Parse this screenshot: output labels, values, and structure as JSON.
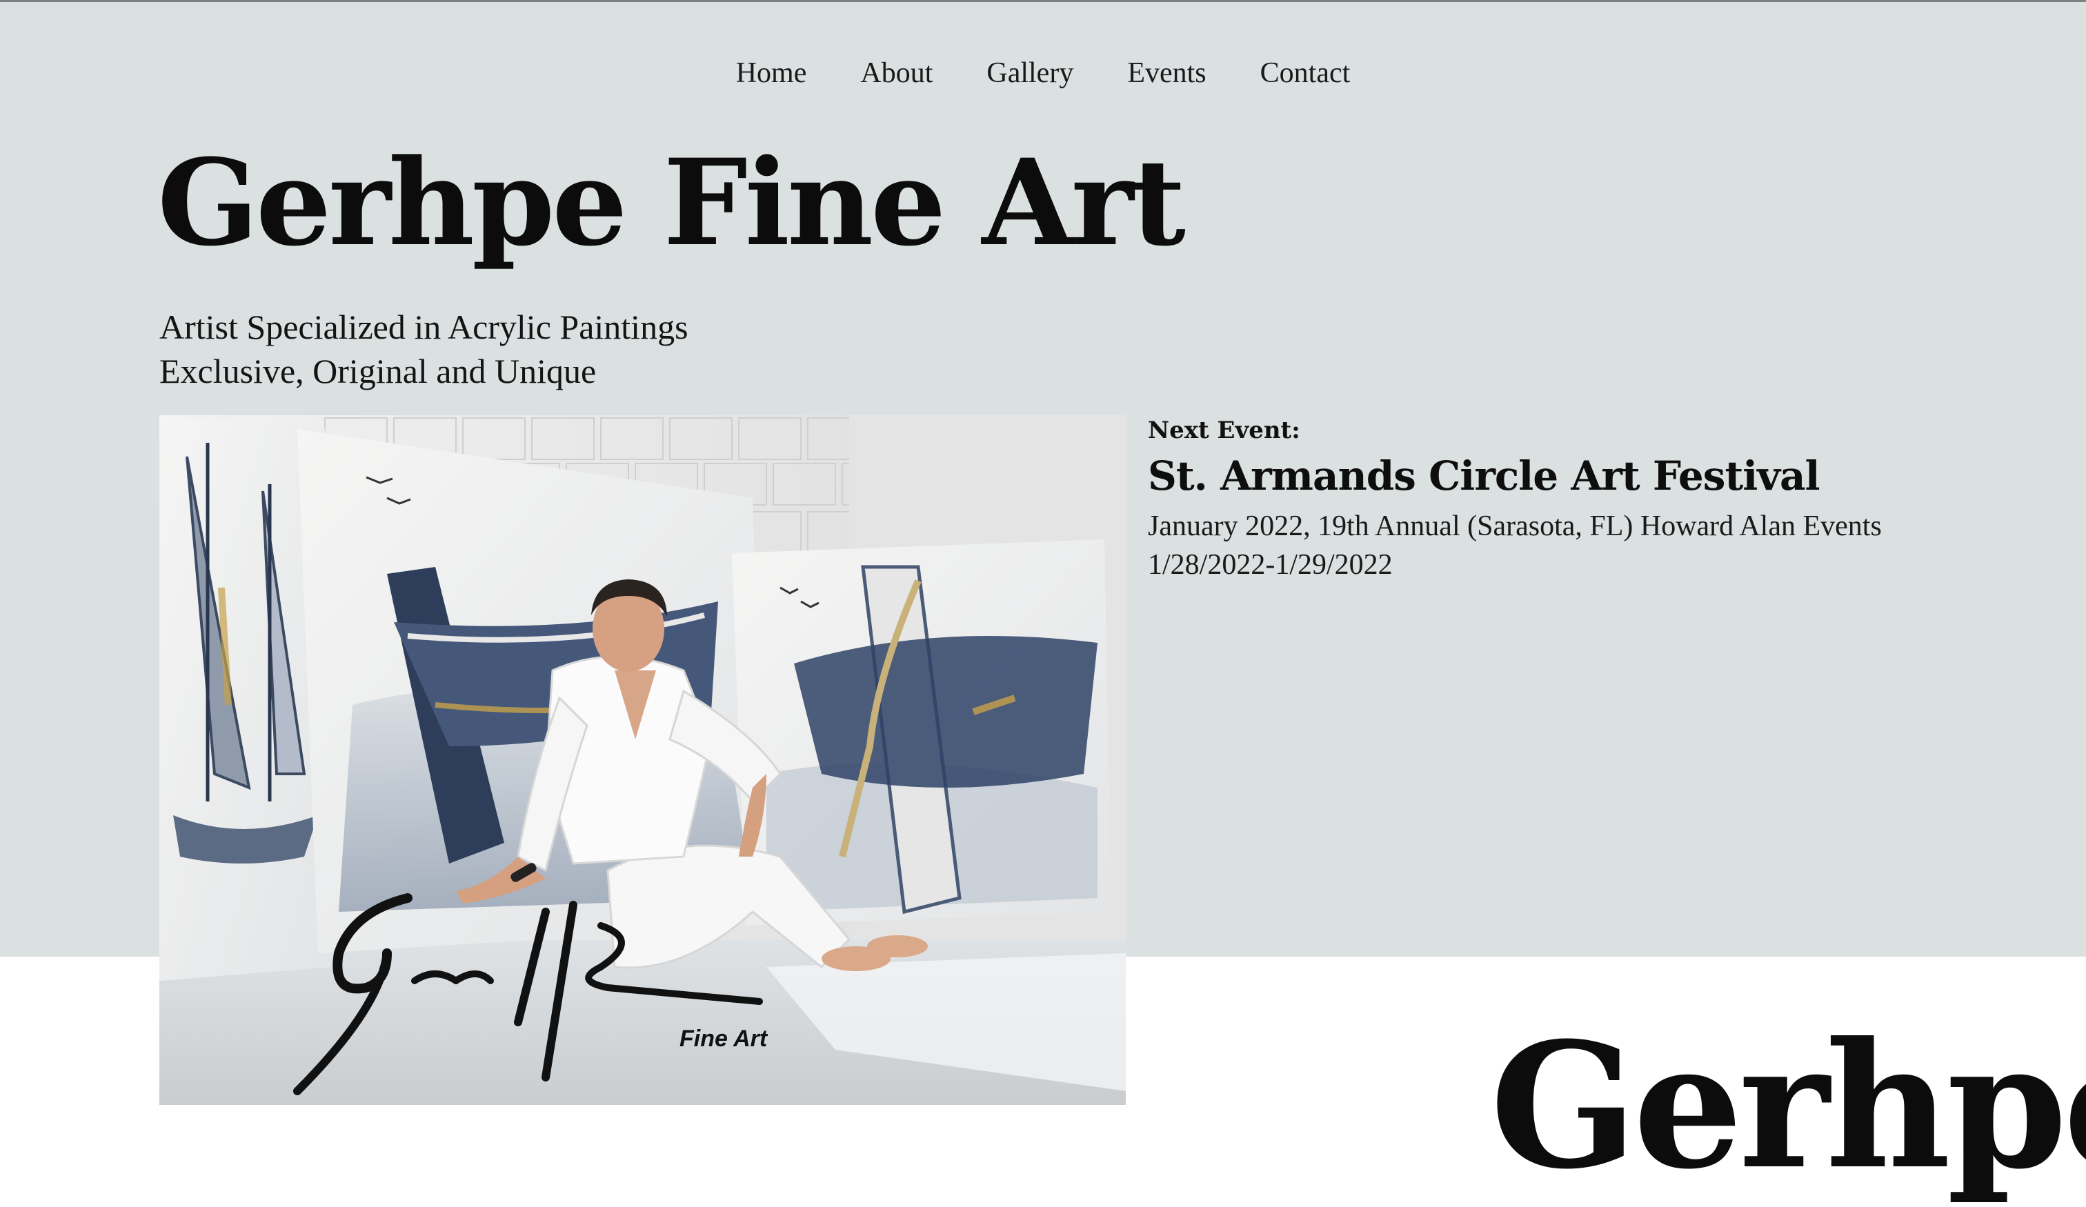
{
  "nav": {
    "items": [
      "Home",
      "About",
      "Gallery",
      "Events",
      "Contact"
    ]
  },
  "hero": {
    "title": "Gerhpe Fine Art",
    "tagline_line1": "Artist Specialized in Acrylic Paintings",
    "tagline_line2": "Exclusive, Original and Unique"
  },
  "photo": {
    "signature_caption": "Fine Art"
  },
  "event": {
    "label": "Next Event:",
    "name": "St. Armands Circle Art Festival",
    "detail": "January 2022, 19th Annual (Sarasota, FL) Howard Alan Events",
    "dates": "1/28/2022-1/29/2022"
  },
  "footer": {
    "title_partial": "Gerhpe"
  },
  "colors": {
    "hero_background": "#dbe0e1",
    "page_background": "#ffffff",
    "text": "#111111"
  }
}
